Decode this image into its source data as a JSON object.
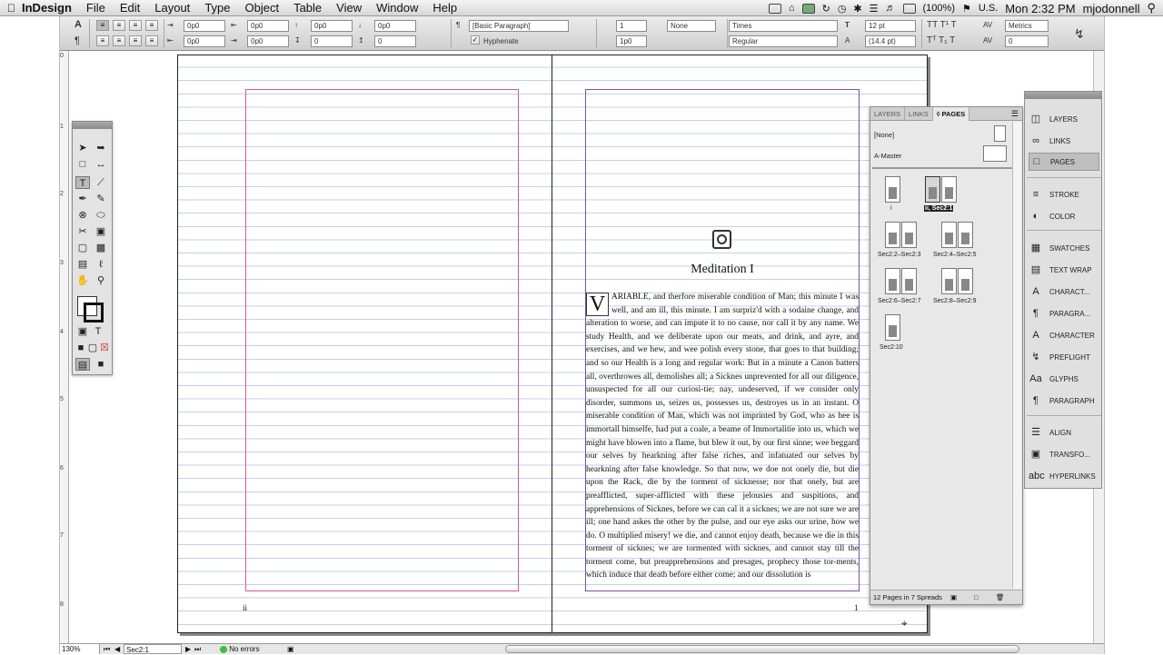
{
  "menubar": {
    "app_name": "InDesign",
    "items": [
      "File",
      "Edit",
      "Layout",
      "Type",
      "Object",
      "Table",
      "View",
      "Window",
      "Help"
    ],
    "battery": "(100%)",
    "locale": "U.S.",
    "clock": "Mon 2:32 PM",
    "user": "mjodonnell"
  },
  "control_panel": {
    "left_indent": "0p0",
    "right_indent": "0p0",
    "first_line_indent": "0p0",
    "last_line_indent": "0p0",
    "space_before": "0p0",
    "space_after": "0p0",
    "drop_cap_lines": "0",
    "drop_cap_chars": "0",
    "paragraph_style": "[Basic Paragraph]",
    "hyphenate_label": "Hyphenate",
    "columns": "1",
    "gutter": "1p0",
    "shading": "None",
    "font_family": "Times",
    "font_style": "Regular",
    "font_size": "12 pt",
    "leading": "(14.4 pt)",
    "kerning": "Metrics",
    "tracking": "0"
  },
  "document": {
    "title": "Meditation I",
    "dropcap_letter": "V",
    "body_text": "ARIABLE, and therfore miserable condition of Man; this minute I was well, and am ill, this minute. I am surpriz'd with a sodaine change, and alteration to worse, and can impute it to no cause, nor call it by any name. We study Health, and we deliberate upon our meats, and drink, and ayre, and exercises, and we hew, and wee polish every stone, that goes to that building; and so our Health is a long and regular work: But in a minute a Canon batters all, overthrowes all, demolishes all; a Sicknes unprevented for all our diligence, unsuspected for all our curiosi-tie; nay, undeserved, if we consider only disorder, summons us, seizes us, possesses us, destroyes us in an instant. O miserable condition of Man, which was not imprinted by God, who as hee is immortall himselfe, had put a coale, a beame of Immortalitie into us, which we might have blowen into a flame, but blew it out, by our first sinne; wee beggard our selves by hearkning after false riches, and infatuated our selves by hearkning after false knowledge. So that now, we doe not onely die, but die upon the Rack, die by the torment of sicknesse; nor that onely, but are preafflicted, super-afflicted with these jelousies and suspitions, and apprehensions of Sicknes, before we can cal it a sicknes; we are not sure we are ill; one hand askes the other by the pulse, and our eye asks our urine, how we do. O multiplied misery! we die, and cannot enjoy death, because we die in this torment of sicknes; we are tormented with sicknes, and cannot stay till the torment come, but preapprehensions and presages, prophecy those tor-ments, which induce that death before either come; and our dissolution is",
    "folio_left": "ii",
    "folio_right": "1"
  },
  "pages_panel": {
    "tabs": [
      "LAYERS",
      "LINKS",
      "◊ PAGES"
    ],
    "masters": [
      "[None]",
      "A-Master"
    ],
    "page_labels": [
      "i",
      "ii, Sec2:1",
      "Sec2:2–Sec2:3",
      "Sec2:4–Sec2:5",
      "Sec2:6–Sec2:7",
      "Sec2:8–Sec2:9",
      "Sec2:10"
    ],
    "footer": "12 Pages in 7 Spreads"
  },
  "dock": {
    "items": [
      "LAYERS",
      "LINKS",
      "PAGES",
      "STROKE",
      "COLOR",
      "SWATCHES",
      "TEXT WRAP",
      "CHARACT...",
      "PARAGRA...",
      "CHARACTER",
      "PREFLIGHT",
      "GLYPHS",
      "PARAGRAPH",
      "ALIGN",
      "TRANSFO...",
      "HYPERLINKS"
    ]
  },
  "statusbar": {
    "zoom": "130%",
    "page": "Sec2:1",
    "preflight": "No errors"
  },
  "ruler": [
    "0",
    "1",
    "2",
    "3",
    "4",
    "5",
    "6",
    "7",
    "8"
  ]
}
